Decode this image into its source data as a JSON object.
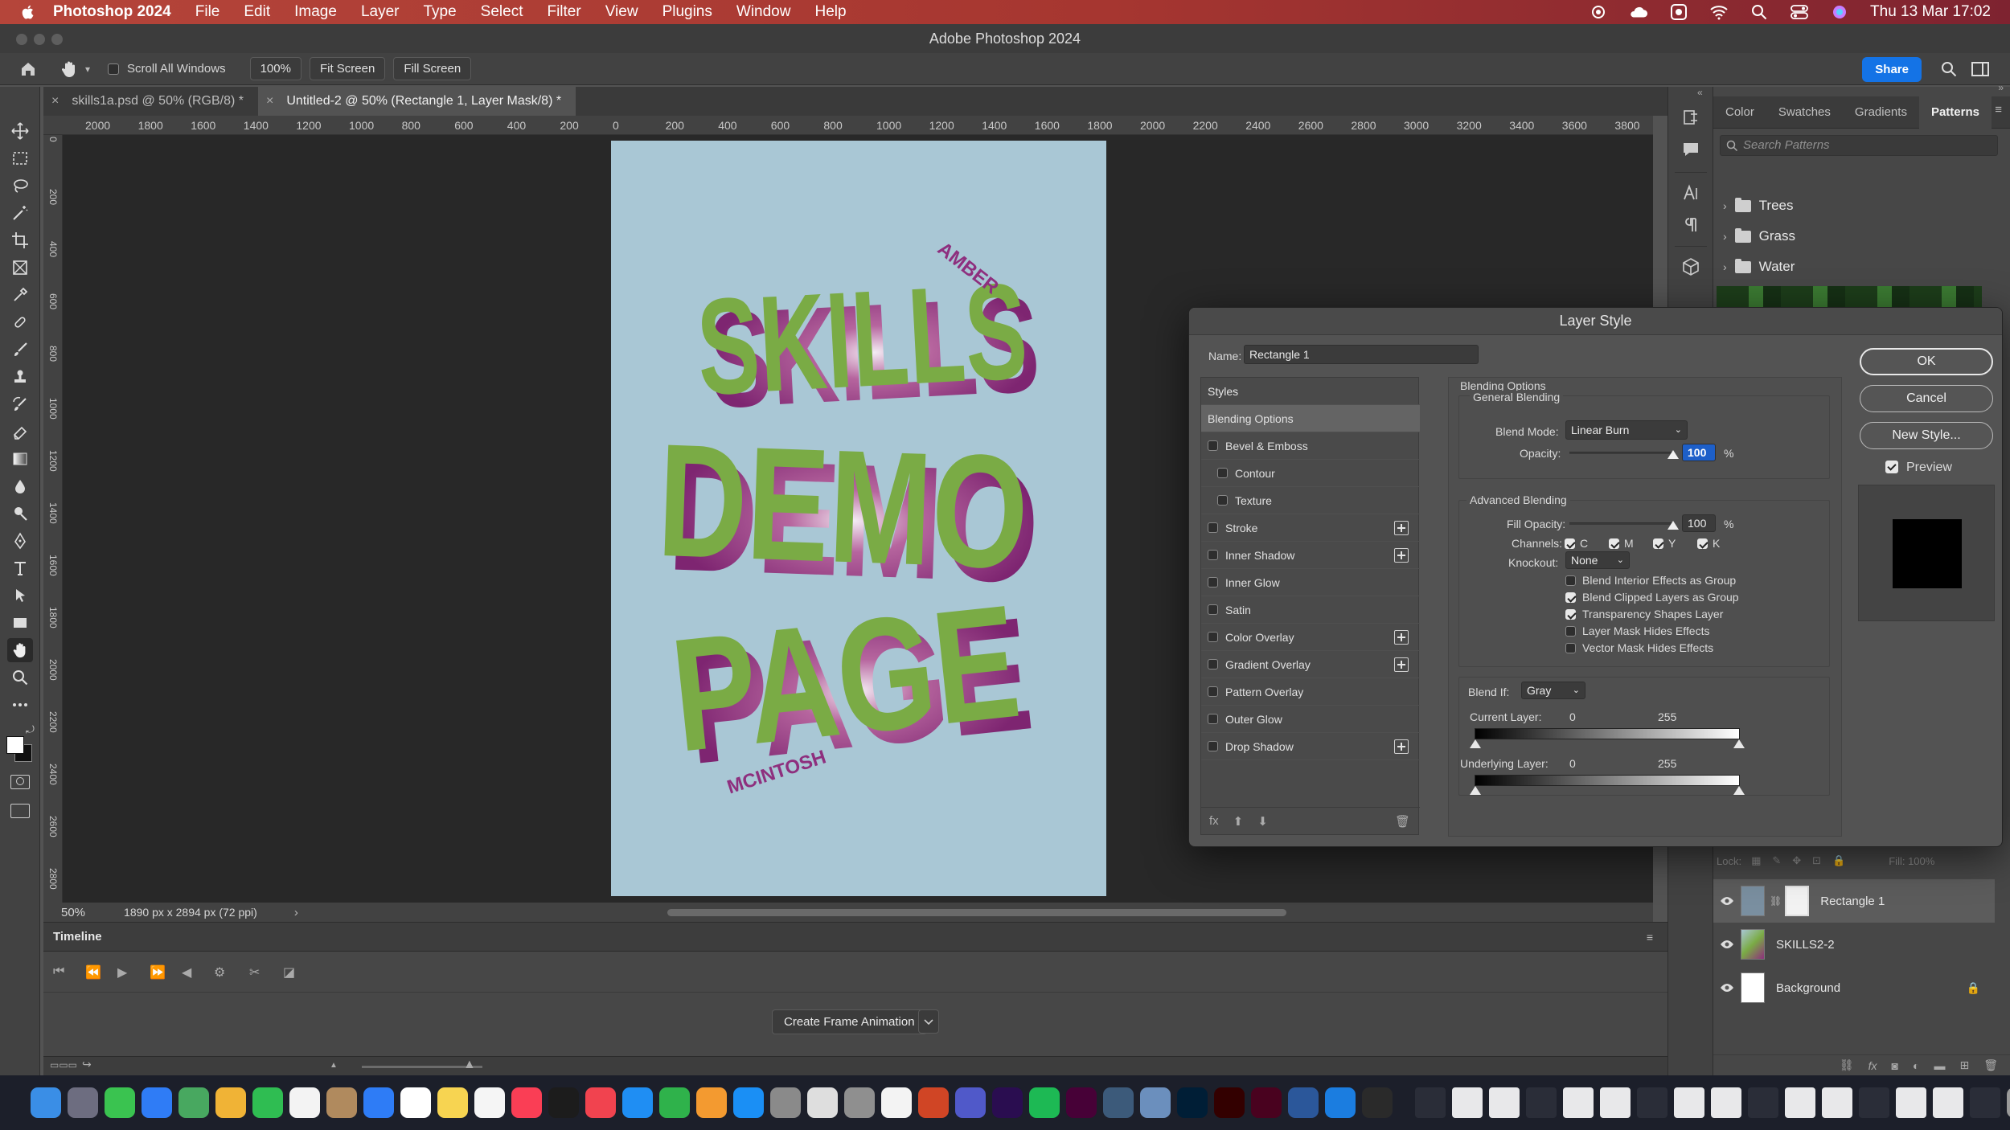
{
  "menubar": {
    "app_name": "Photoshop 2024",
    "items": [
      "File",
      "Edit",
      "Image",
      "Layer",
      "Type",
      "Select",
      "Filter",
      "View",
      "Plugins",
      "Window",
      "Help"
    ],
    "datetime": "Thu 13 Mar  17:02"
  },
  "window": {
    "title": "Adobe Photoshop 2024"
  },
  "options": {
    "scroll_all_windows": "Scroll All Windows",
    "zoom_btn": "100%",
    "fit_screen": "Fit Screen",
    "fill_screen": "Fill Screen",
    "share": "Share"
  },
  "tabs": [
    {
      "label": "skills1a.psd @ 50% (RGB/8) *"
    },
    {
      "label": "Untitled-2 @ 50% (Rectangle 1, Layer Mask/8) *"
    }
  ],
  "ruler_h_labels": [
    "2000",
    "1800",
    "1600",
    "1400",
    "1200",
    "1000",
    "800",
    "600",
    "400",
    "200",
    "0",
    "200",
    "400",
    "600",
    "800",
    "1000",
    "1200",
    "1400",
    "1600",
    "1800",
    "2000",
    "2200",
    "2400",
    "2600",
    "2800",
    "3000",
    "3200",
    "3400",
    "3600",
    "3800"
  ],
  "ruler_v_labels": [
    "0",
    "200",
    "400",
    "600",
    "800",
    "1000",
    "1200",
    "1400",
    "1600",
    "1800",
    "2000",
    "2200",
    "2400",
    "2600",
    "2800"
  ],
  "poster": {
    "line1": "SKILLS",
    "line2": "DEMO",
    "line3": "PAGE",
    "first_name": "AMBER",
    "last_name": "MCINTOSH",
    "bg_color": "#a9c7d5",
    "green": "#7aab45",
    "magenta": "#8e2f7e"
  },
  "status": {
    "zoom": "50%",
    "doc_info": "1890 px x 2894 px (72 ppi)"
  },
  "timeline": {
    "title": "Timeline",
    "create_frame": "Create Frame Animation"
  },
  "right_panel": {
    "tabs": [
      "Color",
      "Swatches",
      "Gradients",
      "Patterns"
    ],
    "search_placeholder": "Search Patterns",
    "groups": [
      "Trees",
      "Grass",
      "Water"
    ],
    "layers": [
      {
        "name": "Rectangle 1"
      },
      {
        "name": "SKILLS2-2"
      },
      {
        "name": "Background"
      }
    ],
    "lock_label": "Lock:",
    "fill_label": "Fill: 100%"
  },
  "dialog": {
    "title": "Layer Style",
    "name_label": "Name:",
    "name_value": "Rectangle 1",
    "styles_header": "Styles",
    "styles": [
      {
        "label": "Blending Options",
        "checkbox": false,
        "plus": false,
        "indent": false,
        "selected": true
      },
      {
        "label": "Bevel & Emboss",
        "checkbox": true,
        "plus": false,
        "indent": false
      },
      {
        "label": "Contour",
        "checkbox": true,
        "plus": false,
        "indent": true
      },
      {
        "label": "Texture",
        "checkbox": true,
        "plus": false,
        "indent": true
      },
      {
        "label": "Stroke",
        "checkbox": true,
        "plus": true,
        "indent": false
      },
      {
        "label": "Inner Shadow",
        "checkbox": true,
        "plus": true,
        "indent": false
      },
      {
        "label": "Inner Glow",
        "checkbox": true,
        "plus": false,
        "indent": false
      },
      {
        "label": "Satin",
        "checkbox": true,
        "plus": false,
        "indent": false
      },
      {
        "label": "Color Overlay",
        "checkbox": true,
        "plus": true,
        "indent": false
      },
      {
        "label": "Gradient Overlay",
        "checkbox": true,
        "plus": true,
        "indent": false
      },
      {
        "label": "Pattern Overlay",
        "checkbox": true,
        "plus": false,
        "indent": false
      },
      {
        "label": "Outer Glow",
        "checkbox": true,
        "plus": false,
        "indent": false
      },
      {
        "label": "Drop Shadow",
        "checkbox": true,
        "plus": true,
        "indent": false
      }
    ],
    "blending_options": "Blending Options",
    "general_blending": "General Blending",
    "blend_mode_label": "Blend Mode:",
    "blend_mode_value": "Linear Burn",
    "opacity_label": "Opacity:",
    "opacity_value": "100",
    "percent": "%",
    "advanced_blending": "Advanced Blending",
    "fill_opacity_label": "Fill Opacity:",
    "fill_opacity_value": "100",
    "channels_label": "Channels:",
    "channels": [
      "C",
      "M",
      "Y",
      "K"
    ],
    "knockout_label": "Knockout:",
    "knockout_value": "None",
    "options": [
      {
        "label": "Blend Interior Effects as Group",
        "checked": false
      },
      {
        "label": "Blend Clipped Layers as Group",
        "checked": true
      },
      {
        "label": "Transparency Shapes Layer",
        "checked": true
      },
      {
        "label": "Layer Mask Hides Effects",
        "checked": false
      },
      {
        "label": "Vector Mask Hides Effects",
        "checked": false
      }
    ],
    "blend_if_label": "Blend If:",
    "blend_if_value": "Gray",
    "current_layer_label": "Current Layer:",
    "underlying_layer_label": "Underlying Layer:",
    "range_low": "0",
    "range_high": "255",
    "ok": "OK",
    "cancel": "Cancel",
    "new_style": "New Style...",
    "preview": "Preview"
  }
}
